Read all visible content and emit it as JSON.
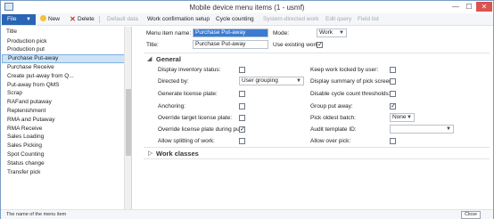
{
  "window": {
    "title": "Mobile device menu items (1 - usmf)"
  },
  "toolbar": {
    "file_label": "File",
    "new_label": "New",
    "delete_label": "Delete",
    "default_data_label": "Default data",
    "work_confirmation_label": "Work confirmation setup",
    "cycle_counting_label": "Cycle counting",
    "system_directed_label": "System-directed work",
    "edit_query_label": "Edit query",
    "field_list_label": "Field list"
  },
  "list": {
    "header": "Title",
    "items": [
      "Production pick",
      "Production put",
      "Purchase Put-away",
      "Purchase Receive",
      "Create put-away from Q...",
      "Put-away from QMS",
      "Scrap",
      "RAFand putaway",
      "Replenishment",
      "RMA and Putaway",
      "RMA Receive",
      "Sales Loading",
      "Sales Picking",
      "Spot Counting",
      "Status change",
      "Transfer pick"
    ],
    "selected_index": 2
  },
  "header_fields": {
    "menu_item_name_label": "Menu item name:",
    "menu_item_name_value": "Purchase Put-away",
    "title_label": "Title:",
    "title_value": "Purchase Put-away",
    "mode_label": "Mode:",
    "mode_value": "Work",
    "use_existing_work_label": "Use existing work:",
    "use_existing_work_checked": true
  },
  "general": {
    "section_title": "General",
    "left": {
      "display_inventory_status_label": "Display inventory status:",
      "directed_by_label": "Directed by:",
      "directed_by_value": "User grouping",
      "generate_license_plate_label": "Generate license plate:",
      "anchoring_label": "Anchoring:",
      "override_target_license_plate_label": "Override target license plate:",
      "override_license_plate_during_put_label": "Override license plate during put:",
      "override_license_plate_during_put_checked": true,
      "allow_splitting_of_work_label": "Allow splitting of work:"
    },
    "right": {
      "keep_work_locked_label": "Keep work locked by user:",
      "display_summary_label": "Display summary of pick screen:",
      "disable_cycle_count_label": "Disable cycle count thresholds:",
      "group_put_away_label": "Group put away:",
      "group_put_away_checked": true,
      "pick_oldest_batch_label": "Pick oldest batch:",
      "pick_oldest_batch_value": "None",
      "audit_template_label": "Audit template ID:",
      "allow_over_pick_label": "Allow over pick:"
    }
  },
  "work_classes": {
    "section_title": "Work classes"
  },
  "status": {
    "help_text": "The name of the menu item",
    "close_label": "Close"
  },
  "icons": {
    "check_glyph": "✓"
  }
}
